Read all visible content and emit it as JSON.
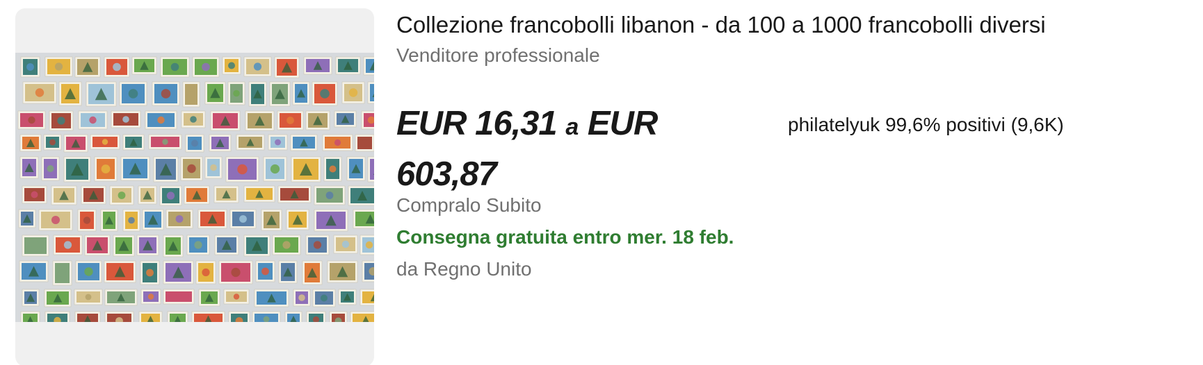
{
  "listing": {
    "title": "Collezione francobolli libanon - da 100 a 1000 francobolli diversi",
    "seller_type": "Venditore professionale",
    "price_from": "EUR 16,31",
    "price_separator": "a",
    "price_to": "EUR 603,87",
    "seller_info": "philatelyuk 99,6% positivi (9,6K)",
    "buy_format": "Compralo Subito",
    "delivery": "Consegna gratuita entro mer. 18 feb.",
    "location": "da Regno Unito",
    "image_icon": "stamp-collection-photo"
  },
  "colors": {
    "delivery_green": "#2f7d31",
    "secondary_text": "#707070",
    "primary_text": "#191919",
    "image_background": "#f0f0f0"
  }
}
